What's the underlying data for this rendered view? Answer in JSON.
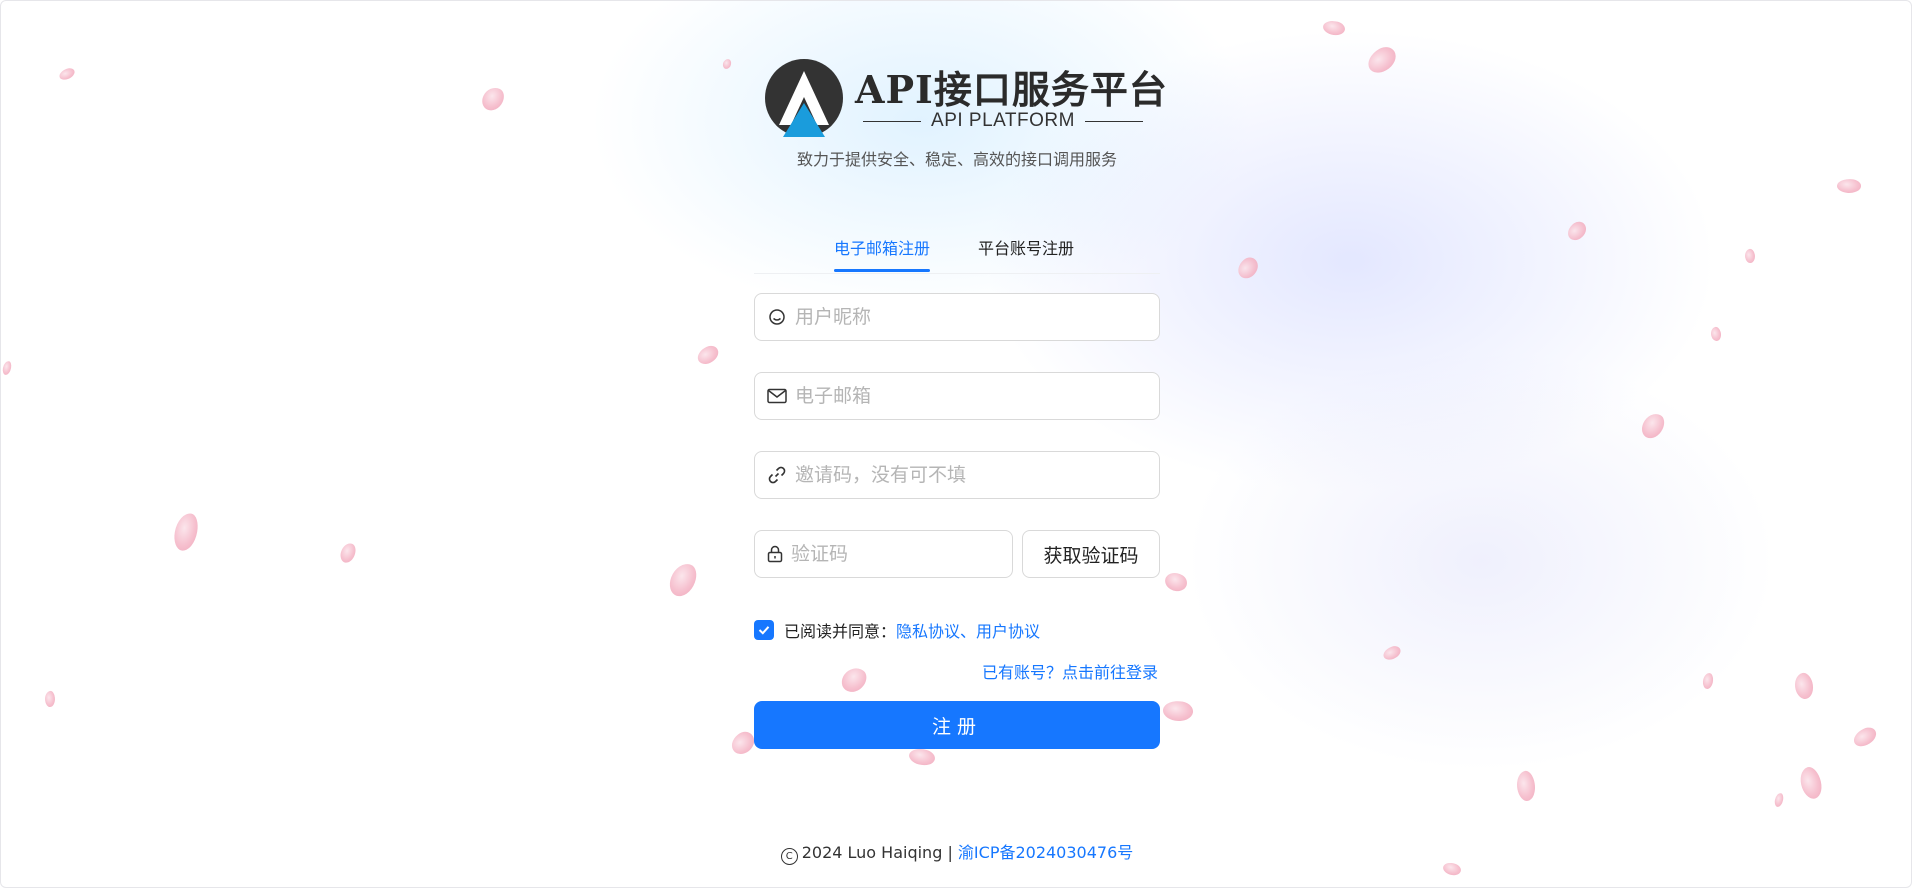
{
  "brand": {
    "title": "API接口服务平台",
    "subtitle": "API PLATFORM",
    "tagline": "致力于提供安全、稳定、高效的接口调用服务"
  },
  "tabs": [
    {
      "label": "电子邮箱注册",
      "active": true
    },
    {
      "label": "平台账号注册",
      "active": false
    }
  ],
  "form": {
    "nickname_placeholder": "用户昵称",
    "email_placeholder": "电子邮箱",
    "invite_placeholder": "邀请码，没有可不填",
    "code_placeholder": "验证码",
    "get_code_label": "获取验证码",
    "agree_prefix": "已阅读并同意：",
    "agree_links": "隐私协议、用户协议",
    "agree_checked": true,
    "login_link": "已有账号？点击前往登录",
    "submit_label": "注册"
  },
  "footer": {
    "copyright": "2024 Luo Haiqing |",
    "icp": "渝ICP备2024030476号"
  },
  "colors": {
    "accent": "#1677ff",
    "petal": "#f5b9c9"
  },
  "icons": [
    "logo-icon",
    "user-icon",
    "mail-icon",
    "link-icon",
    "lock-icon",
    "check-icon",
    "copyright-icon"
  ]
}
